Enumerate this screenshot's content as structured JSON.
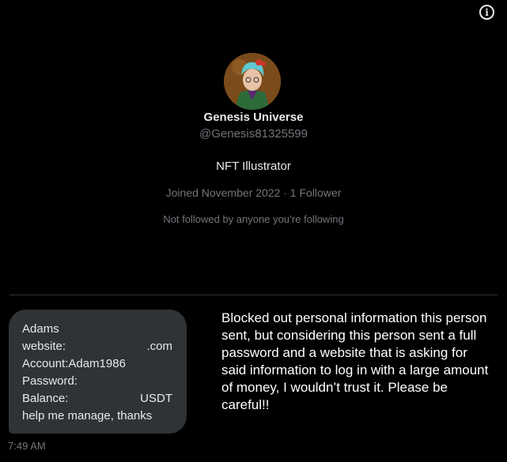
{
  "header": {
    "info_icon": "info-icon"
  },
  "profile": {
    "avatar_icon": "avatar",
    "name": "Genesis Universe",
    "handle": "@Genesis81325599",
    "bio": "NFT Illustrator",
    "meta": "Joined November 2022 · 1 Follower",
    "not_followed": "Not followed by anyone you’re following"
  },
  "message": {
    "line1": "Adams",
    "website_label": "website:",
    "website_value": ".com",
    "account_line": "Account:Adam1986",
    "password_label": "Password:",
    "balance_label": "Balance:",
    "balance_value": "USDT",
    "closing": "help me manage, thanks",
    "time": "7:49 AM"
  },
  "note": "Blocked out personal information this person sent, but considering this person sent a full password and a website that is asking for said information to log in with a large amount of money, I wouldn’t trust it. Please be careful!!"
}
